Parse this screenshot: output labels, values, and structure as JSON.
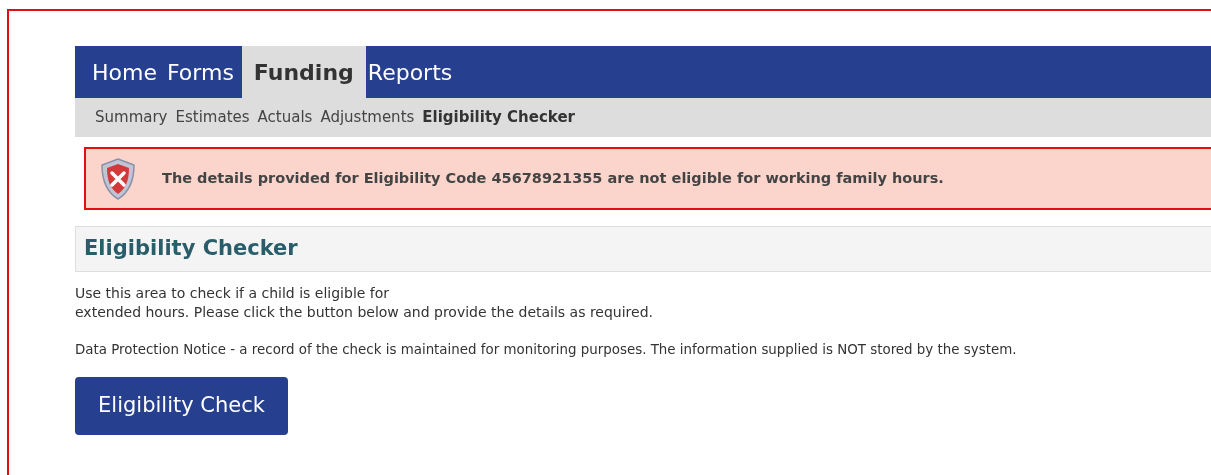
{
  "nav": {
    "tabs": [
      {
        "label": "Home",
        "selected": false
      },
      {
        "label": "Forms",
        "selected": false
      },
      {
        "label": "Funding",
        "selected": true
      },
      {
        "label": "Reports",
        "selected": false
      }
    ],
    "subtabs": [
      {
        "label": "Summary",
        "selected": false
      },
      {
        "label": "Estimates",
        "selected": false
      },
      {
        "label": "Actuals",
        "selected": false
      },
      {
        "label": "Adjustments",
        "selected": false
      },
      {
        "label": "Eligibility Checker",
        "selected": true
      }
    ]
  },
  "alert": {
    "kind": "error",
    "message": "The details provided for Eligibility Code 45678921355 are not eligible for working family hours."
  },
  "panel": {
    "title": "Eligibility Checker",
    "intro_lines": [
      "Use this area to check if a child is eligible for",
      "extended hours. Please click the button below and provide the details as required."
    ],
    "notice": "Data Protection Notice - a record of the check is maintained for monitoring purposes. The information supplied is NOT stored by the system.",
    "button": "Eligibility Check"
  }
}
